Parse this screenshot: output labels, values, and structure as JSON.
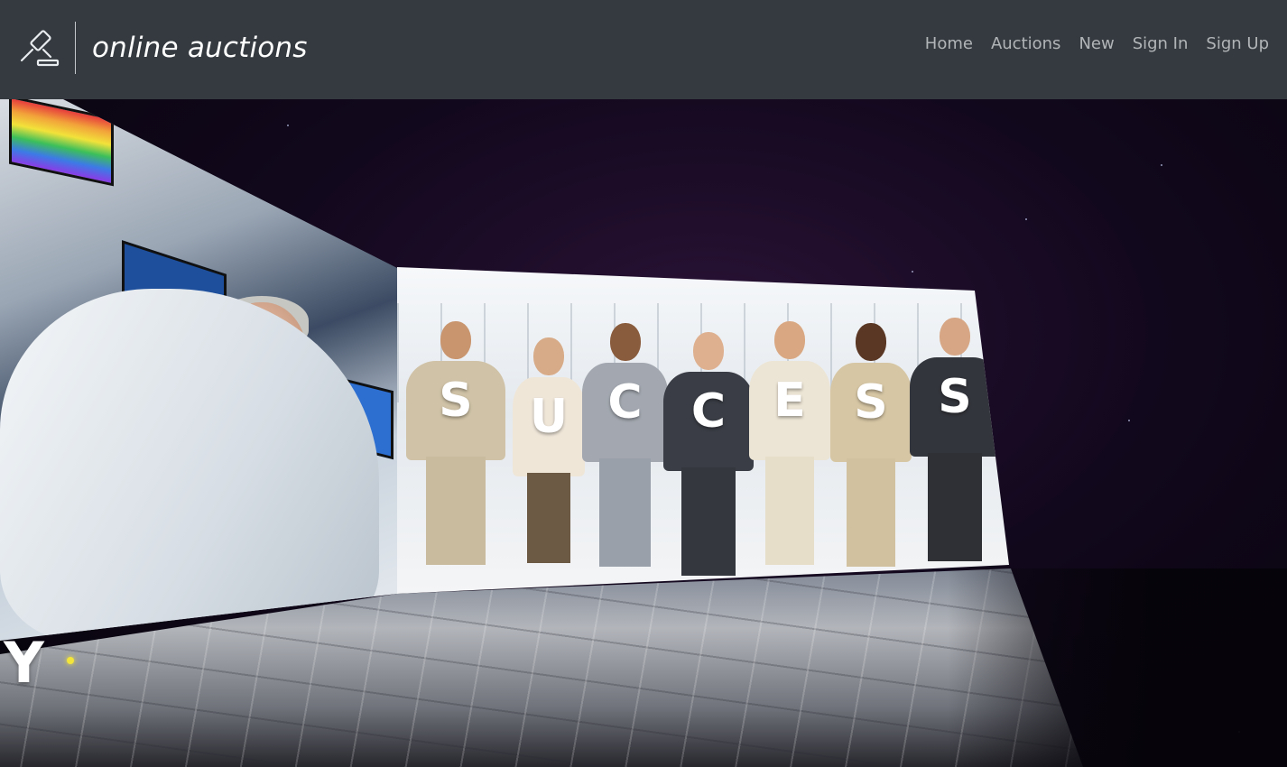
{
  "brand": {
    "title": "online auctions",
    "icon": "gavel-icon"
  },
  "nav": {
    "items": [
      "Home",
      "Auctions",
      "New",
      "Sign In",
      "Sign Up"
    ]
  },
  "hero": {
    "success_letters": [
      "S",
      "U",
      "C",
      "C",
      "E",
      "S",
      "S"
    ],
    "side_letter": "Y"
  },
  "colors": {
    "navbar": "#343a40",
    "nav_link": "rgba(255,255,255,0.62)",
    "brand_text": "#ffffff"
  }
}
